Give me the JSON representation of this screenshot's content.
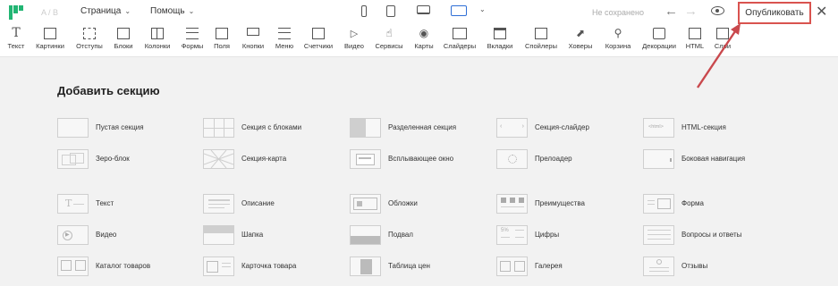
{
  "header": {
    "undo_redo": "A / B",
    "menus": [
      {
        "label": "Страница"
      },
      {
        "label": "Помощь"
      }
    ],
    "save_status": "Не сохранено",
    "publish_label": "Опубликовать"
  },
  "toolbar": {
    "items": [
      {
        "label": "Текст",
        "icon": "text-icon"
      },
      {
        "label": "Картинки",
        "icon": "image-icon"
      },
      {
        "label": "Отступы",
        "icon": "padding-icon"
      },
      {
        "label": "Блоки",
        "icon": "block-icon"
      },
      {
        "label": "Колонки",
        "icon": "columns-icon"
      },
      {
        "label": "Формы",
        "icon": "form-icon"
      },
      {
        "label": "Поля",
        "icon": "field-icon"
      },
      {
        "label": "Кнопки",
        "icon": "button-icon"
      },
      {
        "label": "Меню",
        "icon": "menu-icon"
      },
      {
        "label": "Счетчики",
        "icon": "counter-icon"
      },
      {
        "label": "Видео",
        "icon": "video-icon"
      },
      {
        "label": "Сервисы",
        "icon": "services-icon"
      },
      {
        "label": "Карты",
        "icon": "map-icon"
      },
      {
        "label": "Слайдеры",
        "icon": "slider-icon"
      },
      {
        "label": "Вкладки",
        "icon": "tabs-icon"
      },
      {
        "label": "Спойлеры",
        "icon": "spoiler-icon"
      },
      {
        "label": "Ховеры",
        "icon": "hover-icon"
      },
      {
        "label": "Корзина",
        "icon": "cart-icon"
      },
      {
        "label": "Декорации",
        "icon": "decoration-icon"
      },
      {
        "label": "HTML",
        "icon": "html-icon"
      },
      {
        "label": "Слои",
        "icon": "layers-icon"
      }
    ]
  },
  "main": {
    "title": "Добавить секцию",
    "sections": [
      {
        "label": "Пустая секция"
      },
      {
        "label": "Секция с блоками"
      },
      {
        "label": "Разделенная секция"
      },
      {
        "label": "Секция-слайдер"
      },
      {
        "label": "HTML-секция",
        "thumb_text": "<html>"
      },
      {
        "label": "Зеро-блок"
      },
      {
        "label": "Секция-карта"
      },
      {
        "label": "Всплывающее окно"
      },
      {
        "label": "Прелоадер"
      },
      {
        "label": "Боковая навигация"
      },
      {
        "label": "Текст"
      },
      {
        "label": "Описание"
      },
      {
        "label": "Обложки"
      },
      {
        "label": "Преимущества"
      },
      {
        "label": "Форма"
      },
      {
        "label": "Видео"
      },
      {
        "label": "Шапка"
      },
      {
        "label": "Подвал"
      },
      {
        "label": "Цифры",
        "thumb_text": "5%"
      },
      {
        "label": "Вопросы и ответы"
      },
      {
        "label": "Каталог товаров"
      },
      {
        "label": "Карточка товара"
      },
      {
        "label": "Таблица цен"
      },
      {
        "label": "Галерея"
      },
      {
        "label": "Отзывы"
      }
    ]
  },
  "colors": {
    "brand": "#22b573",
    "accent": "#2f6fd6",
    "highlight": "#d9534f"
  }
}
